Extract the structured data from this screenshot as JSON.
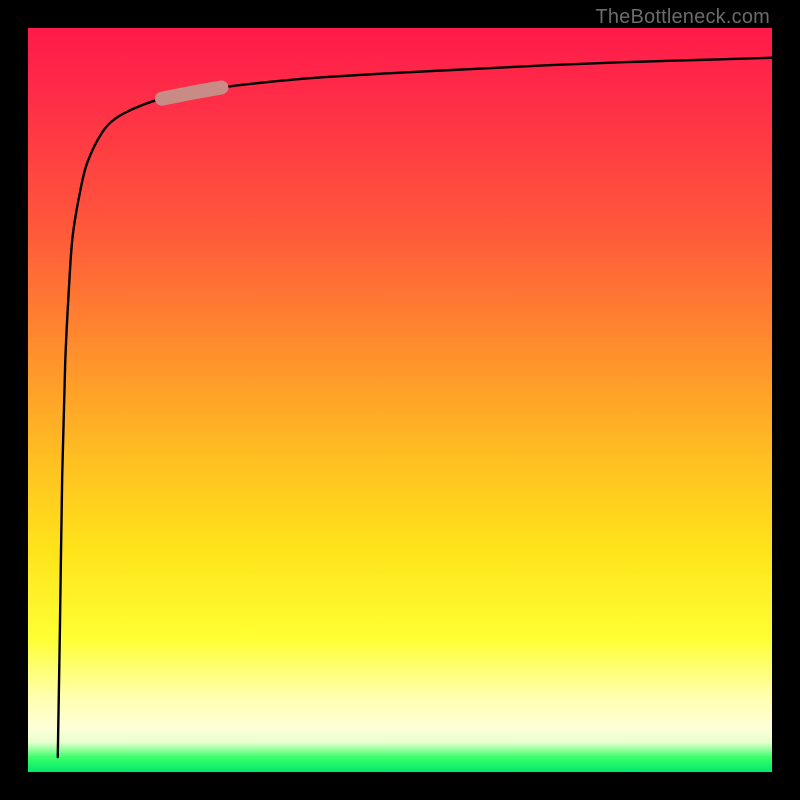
{
  "attribution": "TheBottleneck.com",
  "colors": {
    "background": "#000000",
    "curve_stroke": "#000000",
    "highlight_pill": "#c98b85",
    "gradient_stops": [
      "#ff1a4b",
      "#ff5b3a",
      "#ffb923",
      "#ffff33",
      "#ffffd8",
      "#00e86b"
    ]
  },
  "chart_data": {
    "type": "line",
    "title": "",
    "xlabel": "",
    "ylabel": "",
    "xlim": [
      0,
      100
    ],
    "ylim": [
      0,
      100
    ],
    "x": [
      4,
      4.3,
      4.6,
      5,
      5.5,
      6,
      7,
      8,
      10,
      12,
      15,
      18,
      22,
      26,
      30,
      35,
      40,
      50,
      60,
      70,
      80,
      90,
      100
    ],
    "y": [
      2,
      20,
      40,
      55,
      65,
      72,
      78,
      82,
      86,
      88,
      89.5,
      90.5,
      91.3,
      92,
      92.5,
      93,
      93.4,
      94,
      94.5,
      95,
      95.4,
      95.7,
      96
    ],
    "highlight_segment": {
      "x_start": 18,
      "x_end": 26,
      "note": "emphasized pill segment on the curve"
    },
    "series": [
      {
        "name": "curve",
        "x": [
          4,
          4.3,
          4.6,
          5,
          5.5,
          6,
          7,
          8,
          10,
          12,
          15,
          18,
          22,
          26,
          30,
          35,
          40,
          50,
          60,
          70,
          80,
          90,
          100
        ],
        "y": [
          2,
          20,
          40,
          55,
          65,
          72,
          78,
          82,
          86,
          88,
          89.5,
          90.5,
          91.3,
          92,
          92.5,
          93,
          93.4,
          94,
          94.5,
          95,
          95.4,
          95.7,
          96
        ]
      }
    ]
  }
}
